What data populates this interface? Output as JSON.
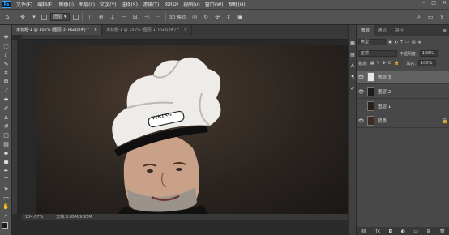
{
  "menubar": {
    "logo": "Ps",
    "items": [
      "文件(F)",
      "编辑(E)",
      "图像(I)",
      "图层(L)",
      "文字(Y)",
      "选择(S)",
      "滤镜(T)",
      "3D(D)",
      "视图(V)",
      "窗口(W)",
      "帮助(H)"
    ],
    "window_controls": [
      "–",
      "□",
      "✕"
    ]
  },
  "options": {
    "move_icon": "move-tool-icon",
    "auto_select_label": "图层",
    "more_label": "···",
    "mode_3d_label": "3D 模式:"
  },
  "tabs": [
    {
      "label": "未标题-1 @ 105% (图层 3, RGB/8#) *",
      "close": "×",
      "active": true
    },
    {
      "label": "未标题-1 @ 150% (图层 1, RGB/8#) *",
      "close": "×",
      "active": false
    }
  ],
  "status": {
    "zoom": "104.67%",
    "doc": "文档:3.89M/9.95M"
  },
  "panels": {
    "tabs": [
      {
        "label": "图层",
        "active": true
      },
      {
        "label": "通道",
        "active": false
      },
      {
        "label": "路径",
        "active": false
      }
    ],
    "kind_label": "类型",
    "blend_mode": "正常",
    "opacity_label": "不透明度:",
    "opacity_value": "100%",
    "lock_label": "锁定:",
    "fill_label": "填充:",
    "fill_value": "100%",
    "layers": [
      {
        "name": "图层 3",
        "selected": true,
        "locked": false
      },
      {
        "name": "图层 2",
        "selected": false,
        "locked": false
      },
      {
        "name": "图层 1",
        "selected": false,
        "locked": false
      },
      {
        "name": "背景",
        "selected": false,
        "locked": true
      }
    ],
    "footer_icons": [
      "link-icon",
      "fx-icon",
      "mask-icon",
      "adjustment-icon",
      "group-icon",
      "new-layer-icon",
      "trash-icon"
    ]
  },
  "hat_logo": "VIKING",
  "colors": {
    "ui_bg": "#535353",
    "panel_bg": "#484848",
    "canvas_bg": "#282828",
    "accent": "#31a8ff"
  }
}
